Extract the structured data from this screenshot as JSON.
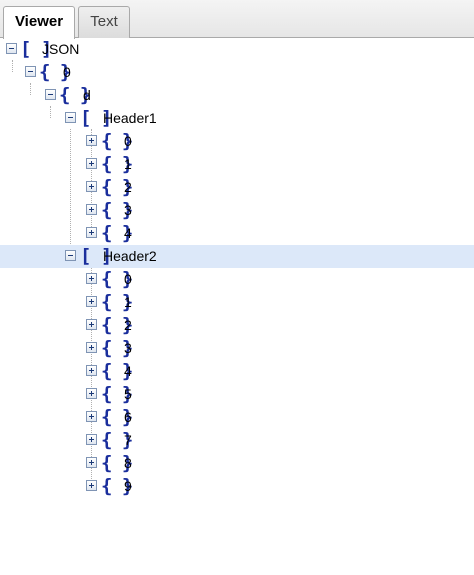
{
  "tabs": [
    {
      "label": "Viewer",
      "active": true
    },
    {
      "label": "Text",
      "active": false
    }
  ],
  "tree": {
    "root_label": "JSON",
    "level1_label": "0",
    "level2_label": "d",
    "header1": {
      "label": "Header1",
      "children": [
        "0",
        "1",
        "2",
        "3",
        "4"
      ]
    },
    "header2": {
      "label": "Header2",
      "selected": true,
      "children": [
        "0",
        "1",
        "2",
        "3",
        "4",
        "5",
        "6",
        "7",
        "8",
        "9"
      ]
    },
    "icons": {
      "array": "[ ]",
      "object": "{ }"
    }
  },
  "colors": {
    "icon": "#1a2e9c",
    "selection": "#dce8f9"
  }
}
